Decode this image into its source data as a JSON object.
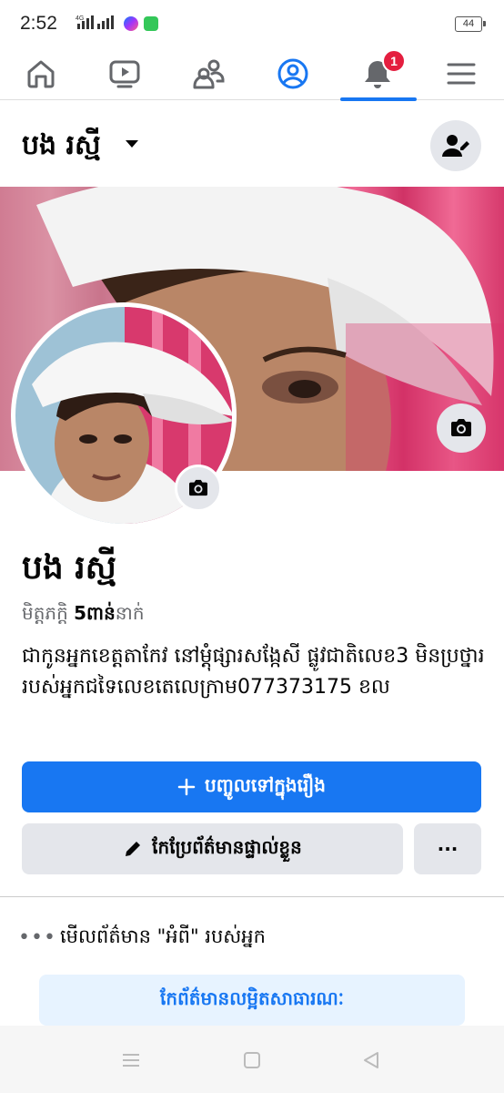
{
  "status": {
    "time": "2:52",
    "network": "4G",
    "battery": "44"
  },
  "nav": {
    "items": [
      {
        "name": "home",
        "icon": "home-icon"
      },
      {
        "name": "watch",
        "icon": "video-icon"
      },
      {
        "name": "friends",
        "icon": "friends-icon"
      },
      {
        "name": "profile",
        "icon": "profile-icon",
        "active": true
      },
      {
        "name": "notifications",
        "icon": "bell-icon",
        "badge": "1"
      },
      {
        "name": "menu",
        "icon": "hamburger-icon"
      }
    ],
    "accent": "#1877f2",
    "badge_color": "#e41e3f"
  },
  "profile": {
    "header_name": "បង រស្មី",
    "name": "បង រស្មី",
    "friends_label": "មិត្តភក្តិ",
    "friends_count": "5ពាន់",
    "friends_suffix": "នាក់",
    "bio": "ជាកូនអ្នកខេត្តតាកែវ នៅម្ដុំផ្សារសង្កែសី ផ្លូវជាតិលេខ3 មិនប្រថ្នាររបស់អ្នកជទៃលេខតេលេក្រាម077373175 ខល"
  },
  "actions": {
    "add_story": "បញ្ចូលទៅក្នុងរឿង",
    "edit_profile": "កែប្រែព័ត៌មានផ្ទាល់ខ្លួន",
    "more": "···"
  },
  "about": {
    "see_about": "មើលព័ត៌មាន \"អំពី\" របស់អ្នក",
    "edit_public": "កែព័ត៌មានលម្អិតសាធារណៈ"
  }
}
